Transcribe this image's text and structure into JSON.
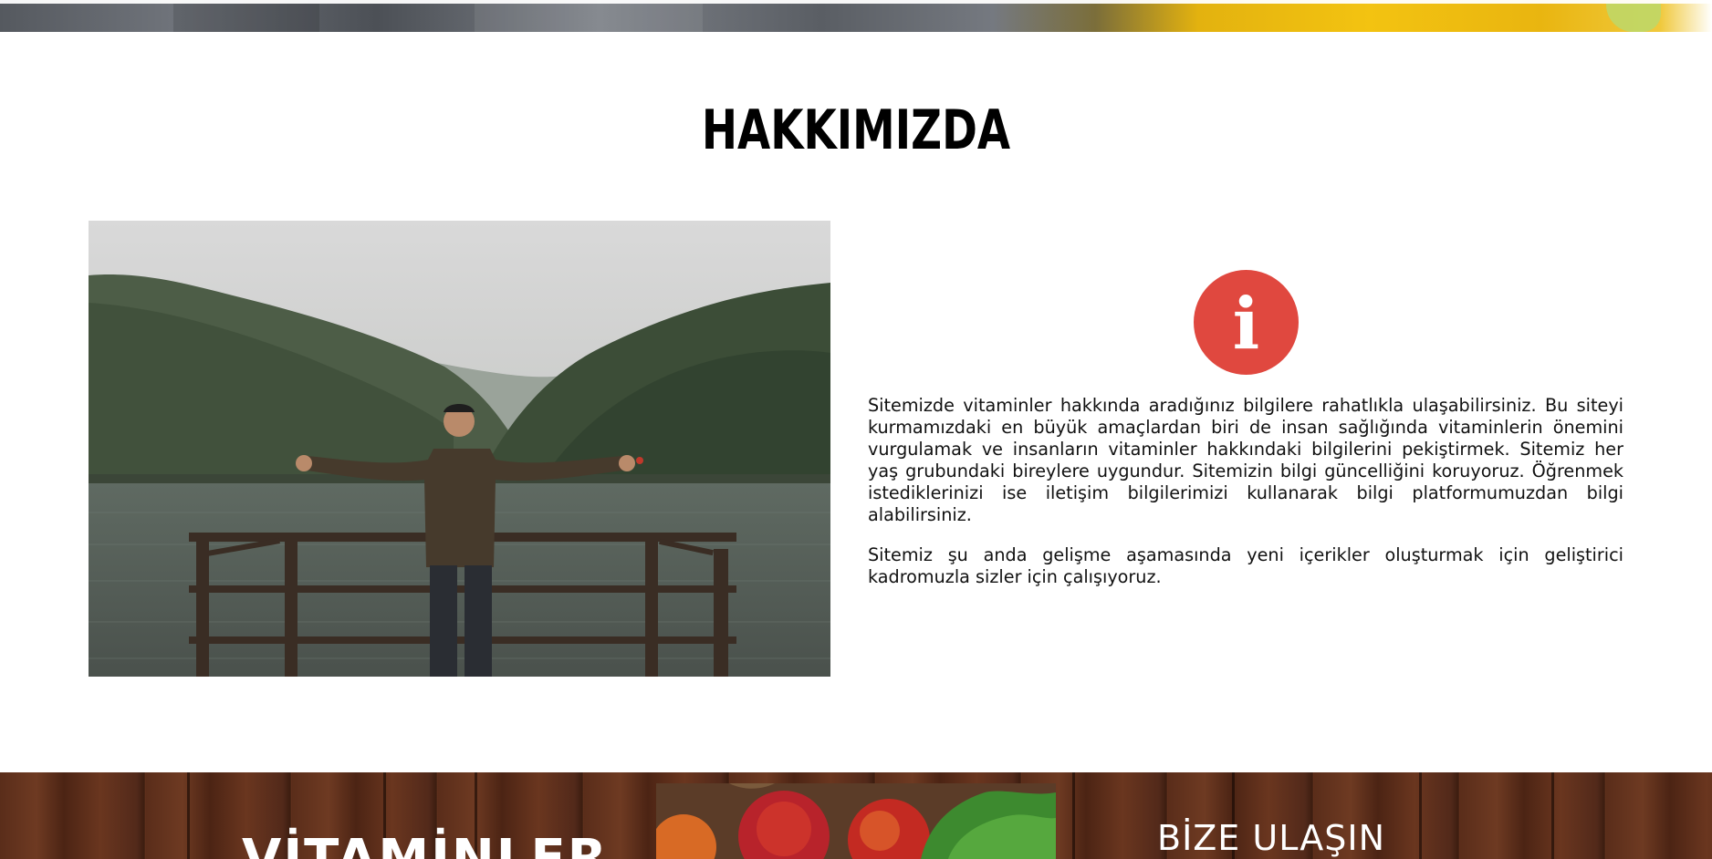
{
  "section": {
    "title": "HAKKIMIZDA"
  },
  "about": {
    "icon": "info-icon",
    "icon_glyph": "i",
    "icon_color": "#e0483f",
    "paragraph_1": "Sitemizde vitaminler hakkında aradığınız bilgilere rahatlıkla ulaşabilirsiniz. Bu siteyi kurmamızdaki en büyük amaçlardan biri de insan sağlığında vitaminlerin önemini vurgulamak ve insanların vitaminler hakkındaki bilgilerini pekiştirmek. Sitemiz her yaş grubundaki bireylere uygundur. Sitemizin bilgi güncelliğini koruyoruz. Öğrenmek istediklerinizi ise iletişim bilgilerimizi kullanarak bilgi platformumuzdan bilgi alabilirsiniz.",
    "paragraph_2": "Sitemiz şu anda gelişme aşamasında yeni içerikler oluşturmak için geliştirici kadromuzla sizler için çalışıyoruz."
  },
  "footer": {
    "vitamins_heading": "VİTAMİNLER",
    "contact_heading": "BİZE ULAŞIN"
  }
}
